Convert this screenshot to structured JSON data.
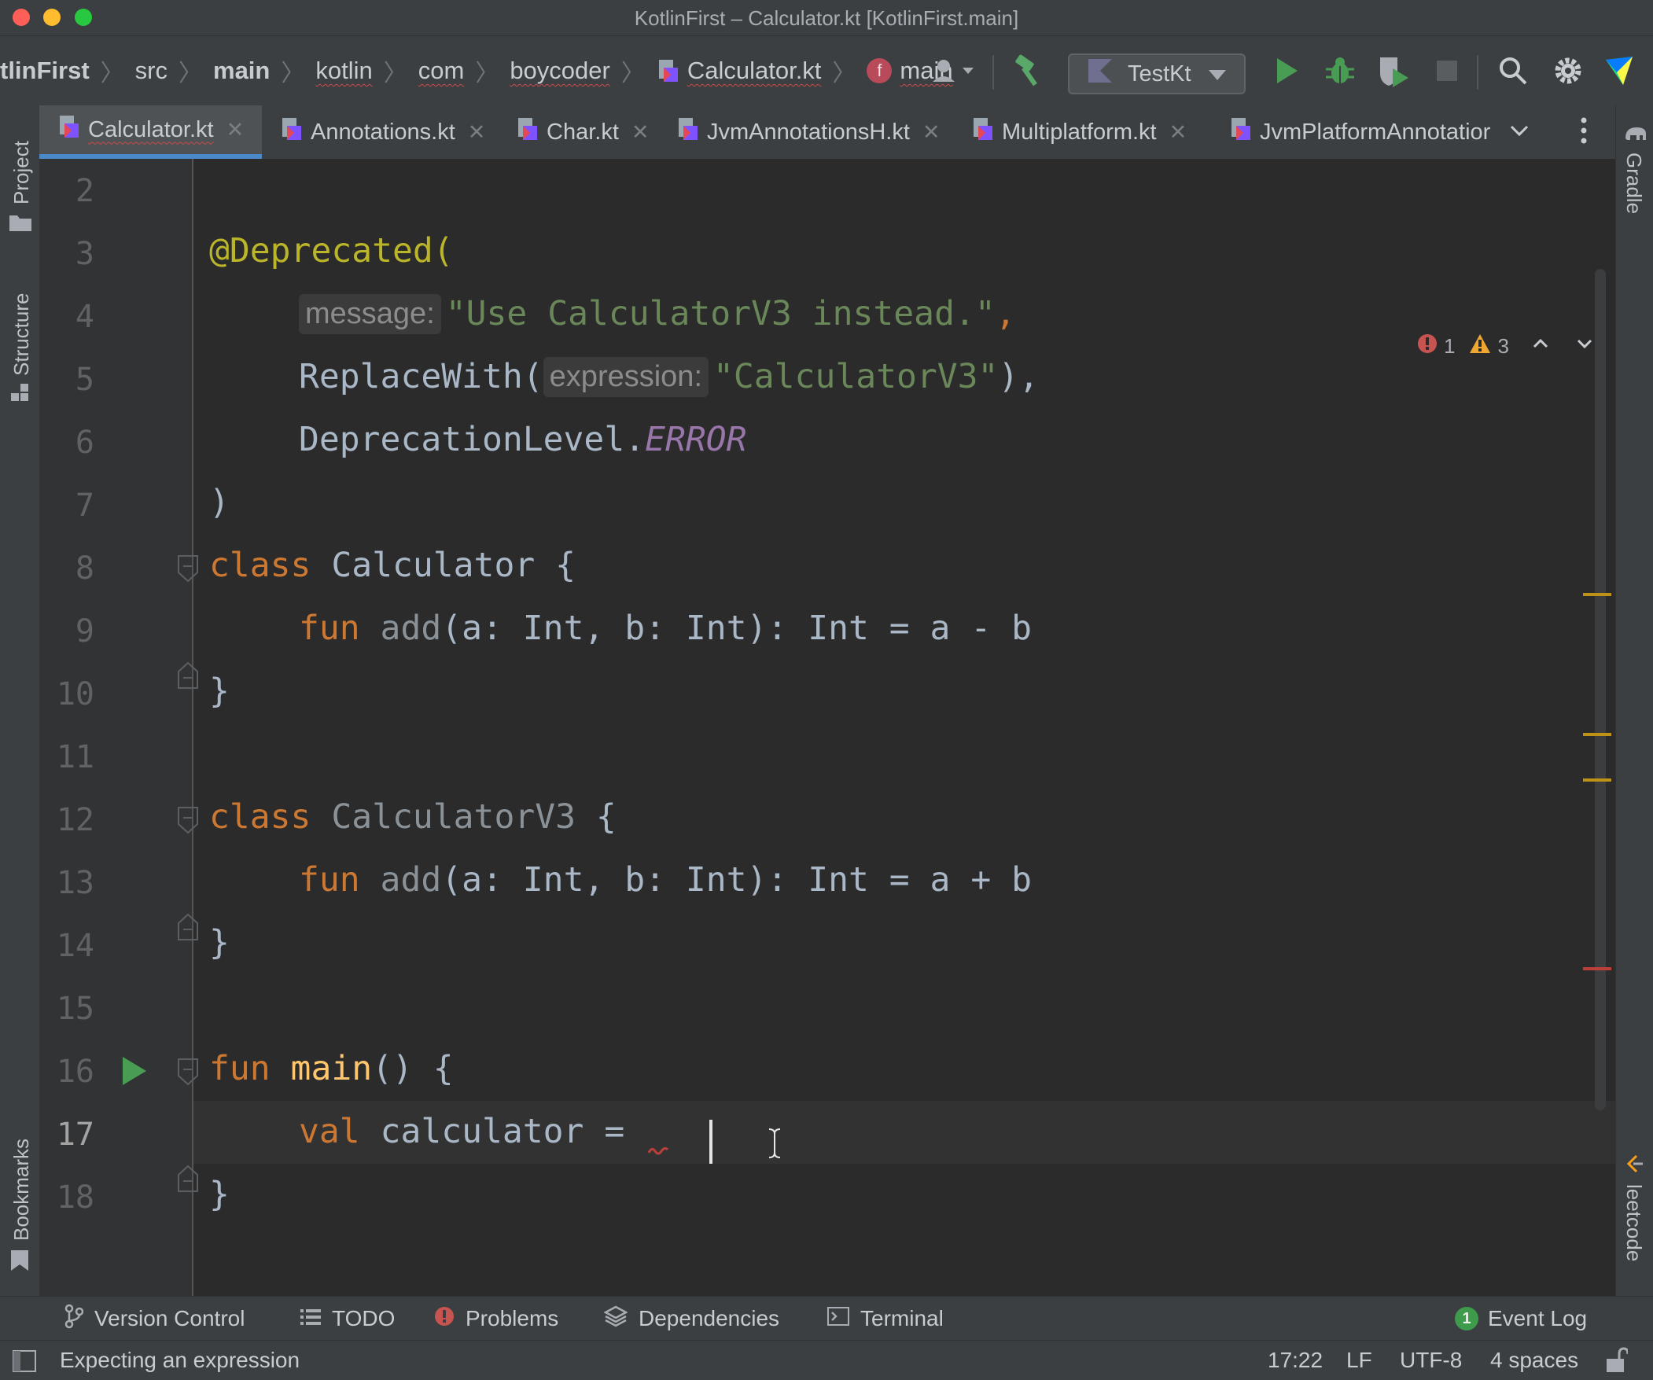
{
  "window": {
    "title": "KotlinFirst – Calculator.kt [KotlinFirst.main]"
  },
  "breadcrumbs": [
    "tlinFirst",
    "src",
    "main",
    "kotlin",
    "com",
    "boycoder",
    "Calculator.kt",
    "main"
  ],
  "toolbar": {
    "run_config": "TestKt"
  },
  "tabs": [
    {
      "label": "Calculator.kt"
    },
    {
      "label": "Annotations.kt"
    },
    {
      "label": "Char.kt"
    },
    {
      "label": "JvmAnnotationsH.kt"
    },
    {
      "label": "Multiplatform.kt"
    },
    {
      "label": "JvmPlatformAnnotatior"
    }
  ],
  "side_panels": {
    "project": "Project",
    "structure": "Structure",
    "bookmarks": "Bookmarks",
    "gradle": "Gradle",
    "leetcode": "leetcode"
  },
  "inspections": {
    "errors": "1",
    "warnings": "3"
  },
  "line_numbers": [
    "2",
    "3",
    "4",
    "5",
    "6",
    "7",
    "8",
    "9",
    "10",
    "11",
    "12",
    "13",
    "14",
    "15",
    "16",
    "17",
    "18"
  ],
  "code": {
    "l3": "@Deprecated(",
    "l4_hint": "message:",
    "l4_str": "\"Use CalculatorV3 instead.\"",
    "l4_comma": ",",
    "l5_a": "ReplaceWith(",
    "l5_hint": "expression:",
    "l5_str": "\"CalculatorV3\"",
    "l5_b": "),",
    "l6_a": "DeprecationLevel.",
    "l6_b": "ERROR",
    "l7": ")",
    "l8_kw": "class",
    "l8_name": " Calculator {",
    "l9_kw": "fun",
    "l9_fn": " add",
    "l9_rest": "(a: Int, b: Int): Int = a - b",
    "l10": "}",
    "l12_kw": "class",
    "l12_name": " CalculatorV3",
    "l12_rest": " {",
    "l13_kw": "fun",
    "l13_fn": " add",
    "l13_rest": "(a: Int, b: Int): Int = a + b",
    "l14": "}",
    "l16_kw": "fun",
    "l16_fn": " main",
    "l16_rest": "() {",
    "l17_kw": "val",
    "l17_rest": " calculator =",
    "l18": "}"
  },
  "tool_windows": [
    "Version Control",
    "TODO",
    "Problems",
    "Dependencies",
    "Terminal"
  ],
  "event_log": {
    "label": "Event Log",
    "count": "1"
  },
  "status": {
    "message": "Expecting an expression",
    "position": "17:22",
    "line_sep": "LF",
    "encoding": "UTF-8",
    "indent": "4 spaces"
  },
  "colors": {
    "background": "#2b2b2b",
    "keyword": "#cc7832",
    "string": "#6a8759",
    "annotation": "#bbb529",
    "function": "#ffc66d",
    "enum": "#9876aa",
    "accent": "#4a88c7"
  }
}
